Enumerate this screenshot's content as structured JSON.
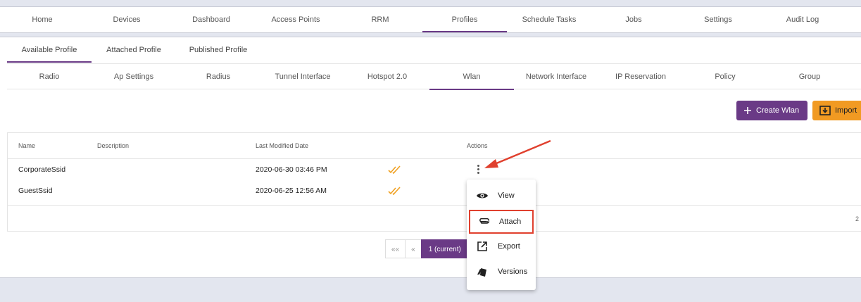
{
  "main_nav": [
    {
      "label": "Home"
    },
    {
      "label": "Devices"
    },
    {
      "label": "Dashboard"
    },
    {
      "label": "Access Points"
    },
    {
      "label": "RRM"
    },
    {
      "label": "Profiles",
      "active": true
    },
    {
      "label": "Schedule Tasks"
    },
    {
      "label": "Jobs"
    },
    {
      "label": "Settings"
    },
    {
      "label": "Audit Log"
    }
  ],
  "profile_tabs": [
    {
      "label": "Available Profile",
      "active": true
    },
    {
      "label": "Attached Profile"
    },
    {
      "label": "Published Profile"
    }
  ],
  "sub_tabs": [
    {
      "label": "Radio"
    },
    {
      "label": "Ap Settings"
    },
    {
      "label": "Radius"
    },
    {
      "label": "Tunnel Interface"
    },
    {
      "label": "Hotspot 2.0"
    },
    {
      "label": "Wlan",
      "active": true
    },
    {
      "label": "Network Interface"
    },
    {
      "label": "IP Reservation"
    },
    {
      "label": "Policy"
    },
    {
      "label": "Group"
    }
  ],
  "toolbar": {
    "create_label": "Create Wlan",
    "import_label": "Import"
  },
  "table": {
    "headers": {
      "name": "Name",
      "description": "Description",
      "modified": "Last Modified Date",
      "actions": "Actions"
    },
    "rows": [
      {
        "name": "CorporateSsid",
        "description": "",
        "modified": "2020-06-30 03:46 PM"
      },
      {
        "name": "GuestSsid",
        "description": "",
        "modified": "2020-06-25 12:56 AM"
      }
    ]
  },
  "pagination": {
    "first": "««",
    "prev": "«",
    "current": "1 (current)"
  },
  "actions_menu": [
    {
      "label": "View",
      "icon": "eye-icon"
    },
    {
      "label": "Attach",
      "icon": "paperclip-icon",
      "highlighted": true
    },
    {
      "label": "Export",
      "icon": "external-link-icon"
    },
    {
      "label": "Versions",
      "icon": "versions-icon"
    }
  ],
  "colors": {
    "accent": "#6a3a86",
    "import": "#f19a22",
    "check": "#f0a020",
    "annotation": "#e0402e"
  }
}
